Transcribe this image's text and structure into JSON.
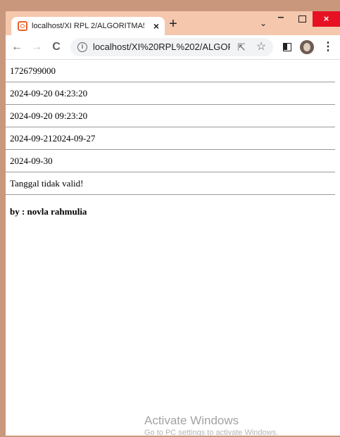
{
  "browser": {
    "tab_title": "localhost/XI RPL 2/ALGORITMA5/",
    "tab_close": "×",
    "new_tab": "+",
    "tab_search": "⌄",
    "win_min": "–",
    "win_close": "×",
    "back": "←",
    "forward": "→",
    "reload": "C",
    "info": "i",
    "url": "localhost/XI%20RPL%202/ALGORI...",
    "share": "⇱",
    "star": "☆",
    "menu": "⋮"
  },
  "page": {
    "lines": [
      "1726799000",
      "2024-09-20 04:23:20",
      "2024-09-20 09:23:20",
      "2024-09-212024-09-27",
      "2024-09-30",
      "Tanggal tidak valid!"
    ],
    "author": "by : novla rahmulia"
  },
  "watermark": {
    "title": "Activate Windows",
    "subtitle": "Go to PC settings to activate Windows."
  },
  "colors": {
    "desktop": "#c9987c",
    "tabstrip": "#f5c7ad",
    "close_red": "#e81123",
    "favicon_accent": "#e8622c"
  },
  "icons": [
    "xampp-favicon-icon",
    "close-icon",
    "plus-icon",
    "chevron-down-icon",
    "minimize-icon",
    "maximize-icon",
    "back-arrow-icon",
    "forward-arrow-icon",
    "reload-icon",
    "info-icon",
    "share-icon",
    "star-icon",
    "side-panel-icon",
    "profile-avatar",
    "kebab-menu-icon"
  ]
}
